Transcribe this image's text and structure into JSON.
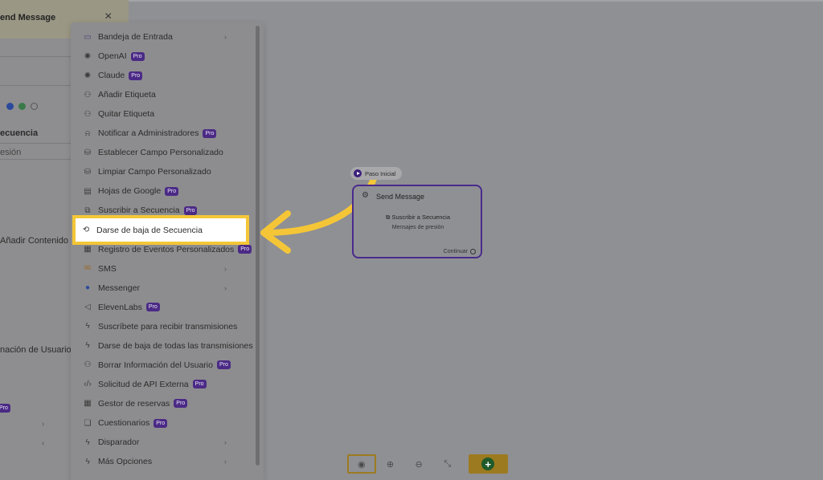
{
  "side_panel": {
    "title": "end Message",
    "close": "×",
    "section_label": "ecuencia",
    "field_text": "esión",
    "add_content": "Añadir Contenido",
    "user_info": "nación de Usuario",
    "pro": "Pro"
  },
  "menu": {
    "items": [
      {
        "label": "Bandeja de Entrada",
        "icon": "inbox-icon",
        "pro": false,
        "chevron": true
      },
      {
        "label": "OpenAI",
        "icon": "openai-icon",
        "pro": true,
        "chevron": false
      },
      {
        "label": "Claude",
        "icon": "claude-icon",
        "pro": true,
        "chevron": false
      },
      {
        "label": "Añadir Etiqueta",
        "icon": "add-tag-icon",
        "pro": false,
        "chevron": false
      },
      {
        "label": "Quitar Etiqueta",
        "icon": "remove-tag-icon",
        "pro": false,
        "chevron": false
      },
      {
        "label": "Notificar a Administradores",
        "icon": "bell-icon",
        "pro": true,
        "chevron": false
      },
      {
        "label": "Establecer Campo Personalizado",
        "icon": "database-icon",
        "pro": false,
        "chevron": false
      },
      {
        "label": "Limpiar Campo Personalizado",
        "icon": "database-clear-icon",
        "pro": false,
        "chevron": false
      },
      {
        "label": "Hojas de Google",
        "icon": "sheets-icon",
        "pro": true,
        "chevron": false
      },
      {
        "label": "Suscribir a Secuencia",
        "icon": "sequence-icon",
        "pro": true,
        "chevron": false
      },
      {
        "label": "Darse de baja de Secuencia",
        "icon": "unsubscribe-sequence-icon",
        "pro": false,
        "chevron": false
      },
      {
        "label": "Registro de Eventos Personalizados",
        "icon": "events-icon",
        "pro": true,
        "chevron": false
      },
      {
        "label": "SMS",
        "icon": "sms-icon",
        "pro": false,
        "chevron": true
      },
      {
        "label": "Messenger",
        "icon": "messenger-icon",
        "pro": false,
        "chevron": true
      },
      {
        "label": "ElevenLabs",
        "icon": "speaker-icon",
        "pro": true,
        "chevron": false
      },
      {
        "label": "Suscríbete para recibir transmisiones",
        "icon": "lightning-icon",
        "pro": false,
        "chevron": false
      },
      {
        "label": "Darse de baja de todas las transmisiones",
        "icon": "lightning-off-icon",
        "pro": false,
        "chevron": false
      },
      {
        "label": "Borrar Información del Usuario",
        "icon": "user-remove-icon",
        "pro": true,
        "chevron": false
      },
      {
        "label": "Solicitud de API Externa",
        "icon": "code-icon",
        "pro": true,
        "chevron": false
      },
      {
        "label": "Gestor de reservas",
        "icon": "calendar-icon",
        "pro": true,
        "chevron": false
      },
      {
        "label": "Cuestionarios",
        "icon": "quiz-icon",
        "pro": true,
        "chevron": false
      },
      {
        "label": "Disparador",
        "icon": "trigger-icon",
        "pro": false,
        "chevron": true
      },
      {
        "label": "Más Opciones",
        "icon": "more-icon",
        "pro": false,
        "chevron": true
      }
    ],
    "highlighted": "Darse de baja de Secuencia",
    "pro_label": "Pro"
  },
  "node": {
    "start_label": "Paso Inicial",
    "title": "Send Message",
    "action": "Suscribir a Secuencia",
    "subtitle": "Mensajes de presión",
    "continue": "Continuar"
  },
  "colors": {
    "highlight_border": "#f4c637",
    "arrow": "#f4c637",
    "node_border": "#4a2a8c",
    "pro_badge": "#4b2a86"
  }
}
